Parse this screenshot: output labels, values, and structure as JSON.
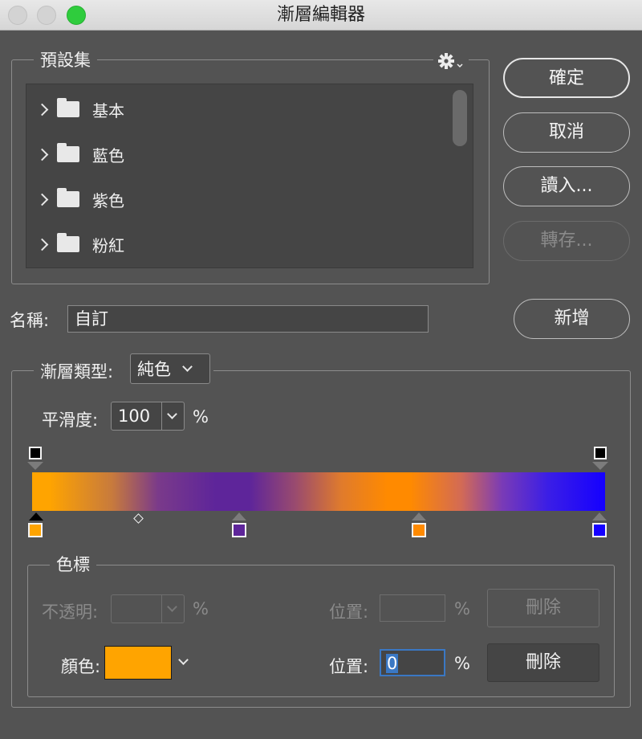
{
  "window": {
    "title": "漸層編輯器"
  },
  "presets": {
    "legend": "預設集",
    "settings_icon": "gear-icon",
    "items": [
      {
        "label": "基本"
      },
      {
        "label": "藍色"
      },
      {
        "label": "紫色"
      },
      {
        "label": "粉紅"
      }
    ]
  },
  "buttons": {
    "ok": "確定",
    "cancel": "取消",
    "load": "讀入...",
    "save": "轉存...",
    "new": "新增"
  },
  "name_field": {
    "label": "名稱:",
    "value": "自訂"
  },
  "gradient": {
    "type_label": "漸層類型:",
    "type_value": "純色",
    "smoothness_label": "平滑度:",
    "smoothness_value": "100",
    "percent": "%",
    "color_stops": [
      {
        "color": "#ffa400",
        "location": 0,
        "selected": true
      },
      {
        "color": "#5e259a",
        "location": 36
      },
      {
        "color": "#ff8a00",
        "location": 67
      },
      {
        "color": "#1500ff",
        "location": 100
      }
    ],
    "opacity_stops": [
      {
        "color": "#000000",
        "location": 0
      },
      {
        "color": "#000000",
        "location": 100
      }
    ],
    "midpoint_location": 19
  },
  "stops_panel": {
    "legend": "色標",
    "opacity_label": "不透明:",
    "opacity_value": "",
    "percent": "%",
    "location_label": "位置:",
    "location_opacity_value": "",
    "delete_label": "刪除",
    "color_label": "顏色:",
    "color_value": "#ffa400",
    "location_color_value": "0"
  }
}
